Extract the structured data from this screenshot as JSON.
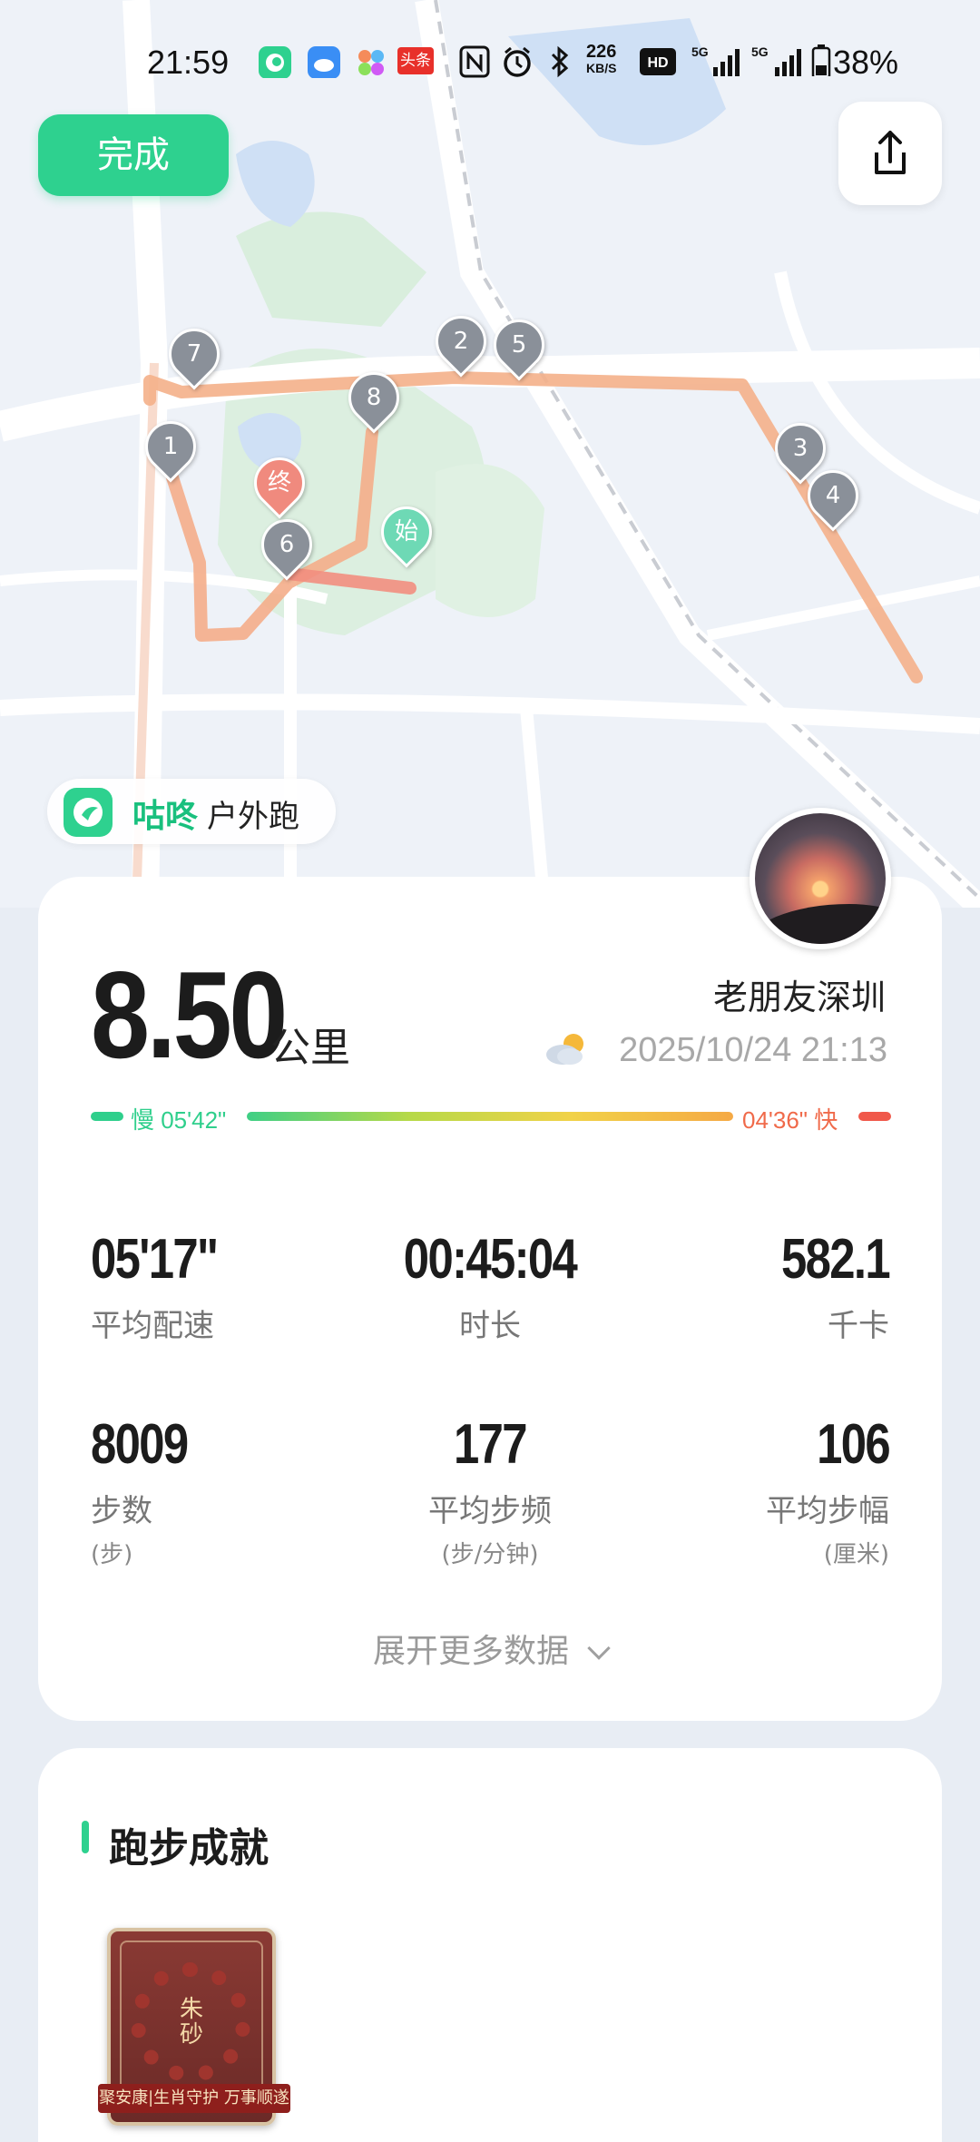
{
  "status_bar": {
    "time": "21:59",
    "net_speed_value": "226",
    "net_speed_unit": "KB/S",
    "battery": "38%",
    "icons": [
      "app-icon-gudong",
      "weather-icon",
      "app-icon-colorful",
      "toutiao-icon",
      "nfc-icon",
      "alarm-icon",
      "bluetooth-icon",
      "hd-icon",
      "signal-5g-icon",
      "signal-5g-icon",
      "battery-icon"
    ],
    "toutiao_label": "头条"
  },
  "top": {
    "done_label": "完成",
    "share_icon": "share-icon"
  },
  "map": {
    "start_label": "始",
    "end_label": "终",
    "km_markers": [
      "1",
      "2",
      "3",
      "4",
      "5",
      "6",
      "7",
      "8"
    ],
    "route_color": "#f4b08a"
  },
  "brand": {
    "name": "咕咚",
    "mode": "户外跑",
    "color": "#19c07e"
  },
  "summary": {
    "distance": "8.50",
    "distance_unit": "公里",
    "nickname": "老朋友深圳",
    "weather_icon": "partly-cloudy-icon",
    "datetime": "2025/10/24 21:13",
    "pace_slow": "慢 05'42\"",
    "pace_fast": "04'36\" 快"
  },
  "stats_row1": [
    {
      "value": "05'17\"",
      "label": "平均配速"
    },
    {
      "value": "00:45:04",
      "label": "时长"
    },
    {
      "value": "582.1",
      "label": "千卡"
    }
  ],
  "stats_row2": [
    {
      "value": "8009",
      "label": "步数",
      "sub": "(步)"
    },
    {
      "value": "177",
      "label": "平均步频",
      "sub": "(步/分钟)"
    },
    {
      "value": "106",
      "label": "平均步幅",
      "sub": "(厘米)"
    }
  ],
  "expand_label": "展开更多数据",
  "achievements": {
    "title": "跑步成就",
    "badge_name": "朱砂",
    "badge_caption": "聚安康|生肖守护 万事顺遂"
  }
}
